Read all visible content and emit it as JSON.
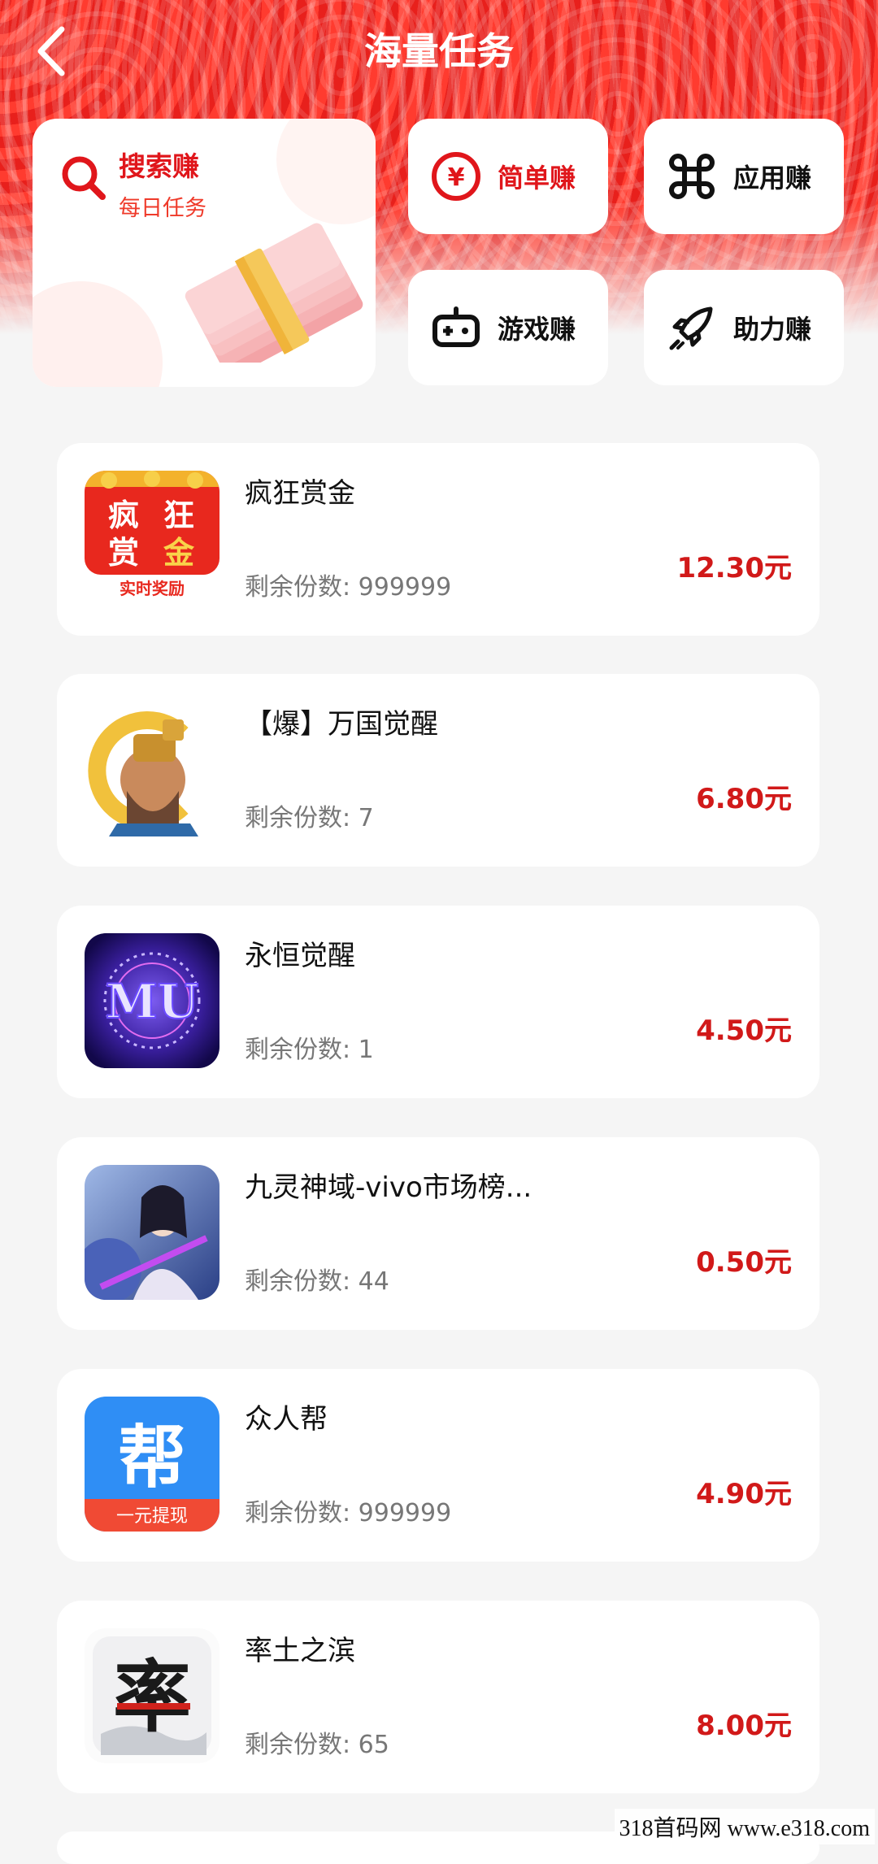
{
  "header": {
    "title": "海量任务"
  },
  "categories": {
    "featured": {
      "title": "搜索赚",
      "subtitle": "每日任务"
    },
    "items": [
      {
        "label": "简单赚"
      },
      {
        "label": "应用赚"
      },
      {
        "label": "游戏赚"
      },
      {
        "label": "助力赚"
      }
    ]
  },
  "tasks": [
    {
      "name": "疯狂赏金",
      "remaining": "剩余份数: 999999",
      "price": "12.30元",
      "icon_text": [
        "疯",
        "狂",
        "赏",
        "金"
      ],
      "icon_sub": "实时奖励"
    },
    {
      "name": "【爆】万国觉醒",
      "remaining": "剩余份数: 7",
      "price": "6.80元"
    },
    {
      "name": "永恒觉醒",
      "remaining": "剩余份数: 1",
      "price": "4.50元",
      "icon_text": "MU"
    },
    {
      "name": "九灵神域-vivo市场榜...",
      "remaining": "剩余份数: 44",
      "price": "0.50元"
    },
    {
      "name": "众人帮",
      "remaining": "剩余份数: 999999",
      "price": "4.90元",
      "icon_text": "帮",
      "icon_sub": "一元提现"
    },
    {
      "name": "率土之滨",
      "remaining": "剩余份数: 65",
      "price": "8.00元",
      "icon_text": "率"
    }
  ],
  "watermark": "318首码网 www.e318.com",
  "colors": {
    "brand_red": "#e0161b",
    "price_red": "#d11919",
    "header_red": "#ff3b2f"
  }
}
